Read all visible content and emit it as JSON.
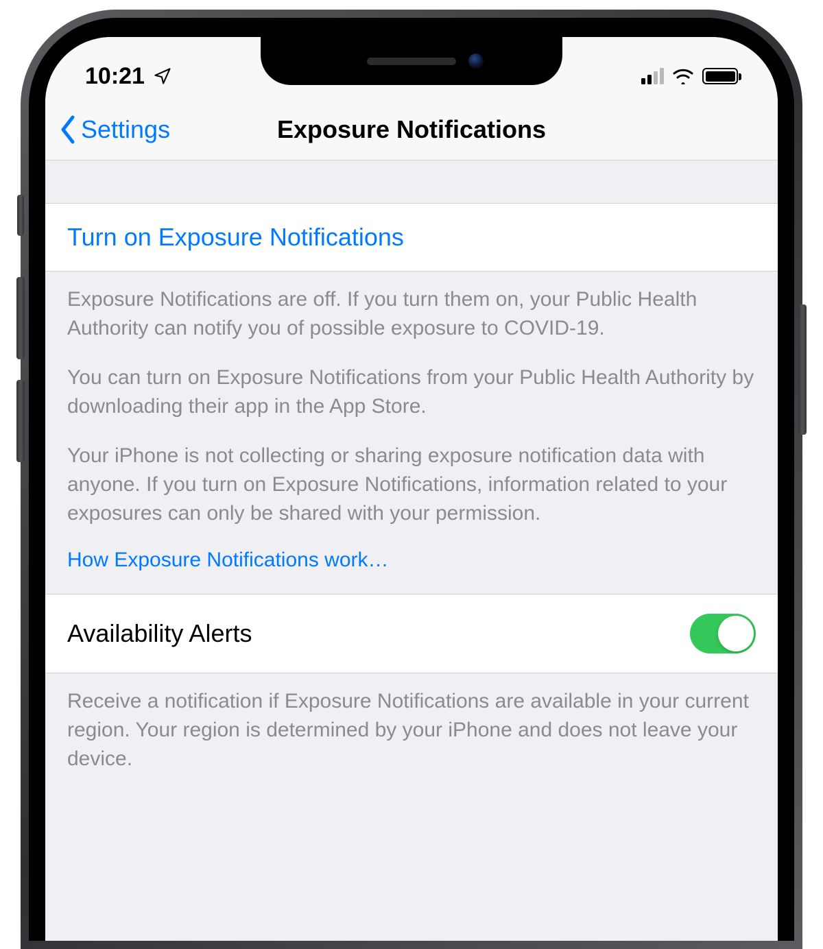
{
  "statusBar": {
    "time": "10:21"
  },
  "nav": {
    "back": "Settings",
    "title": "Exposure Notifications"
  },
  "sections": {
    "turnOn": {
      "label": "Turn on Exposure Notifications",
      "desc1": "Exposure Notifications are off. If you turn them on, your Public Health Authority can notify you of possible exposure to COVID-19.",
      "desc2": "You can turn on Exposure Notifications from your Public Health Authority by downloading their app in the App Store.",
      "desc3": "Your iPhone is not collecting or sharing exposure notification data with anyone. If you turn on Exposure Notifications, information related to your exposures can only be shared with your permission.",
      "link": "How Exposure Notifications work…"
    },
    "alerts": {
      "label": "Availability Alerts",
      "desc": "Receive a notification if Exposure Notifications are available in your current region. Your region is determined by your iPhone and does not leave your device."
    }
  }
}
